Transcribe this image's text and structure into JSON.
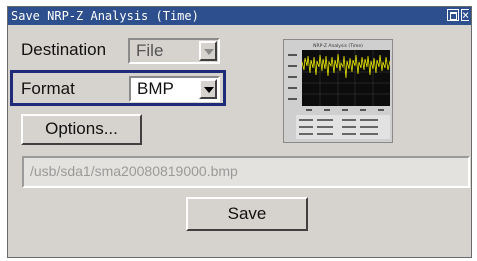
{
  "window": {
    "title": "Save NRP-Z Analysis (Time)"
  },
  "destination": {
    "label": "Destination",
    "value": "File"
  },
  "format": {
    "label": "Format",
    "value": "BMP"
  },
  "options_button": {
    "label": "Options..."
  },
  "file_path": {
    "value": "/usb/sda1/sma20080819000.bmp"
  },
  "save_button": {
    "label": "Save"
  },
  "preview": {
    "title": "NRP-Z Analysis (Time)"
  },
  "colors": {
    "titlebar": "#2d4f8e",
    "focus": "#1f2a7a",
    "trace": "#e8e800"
  }
}
